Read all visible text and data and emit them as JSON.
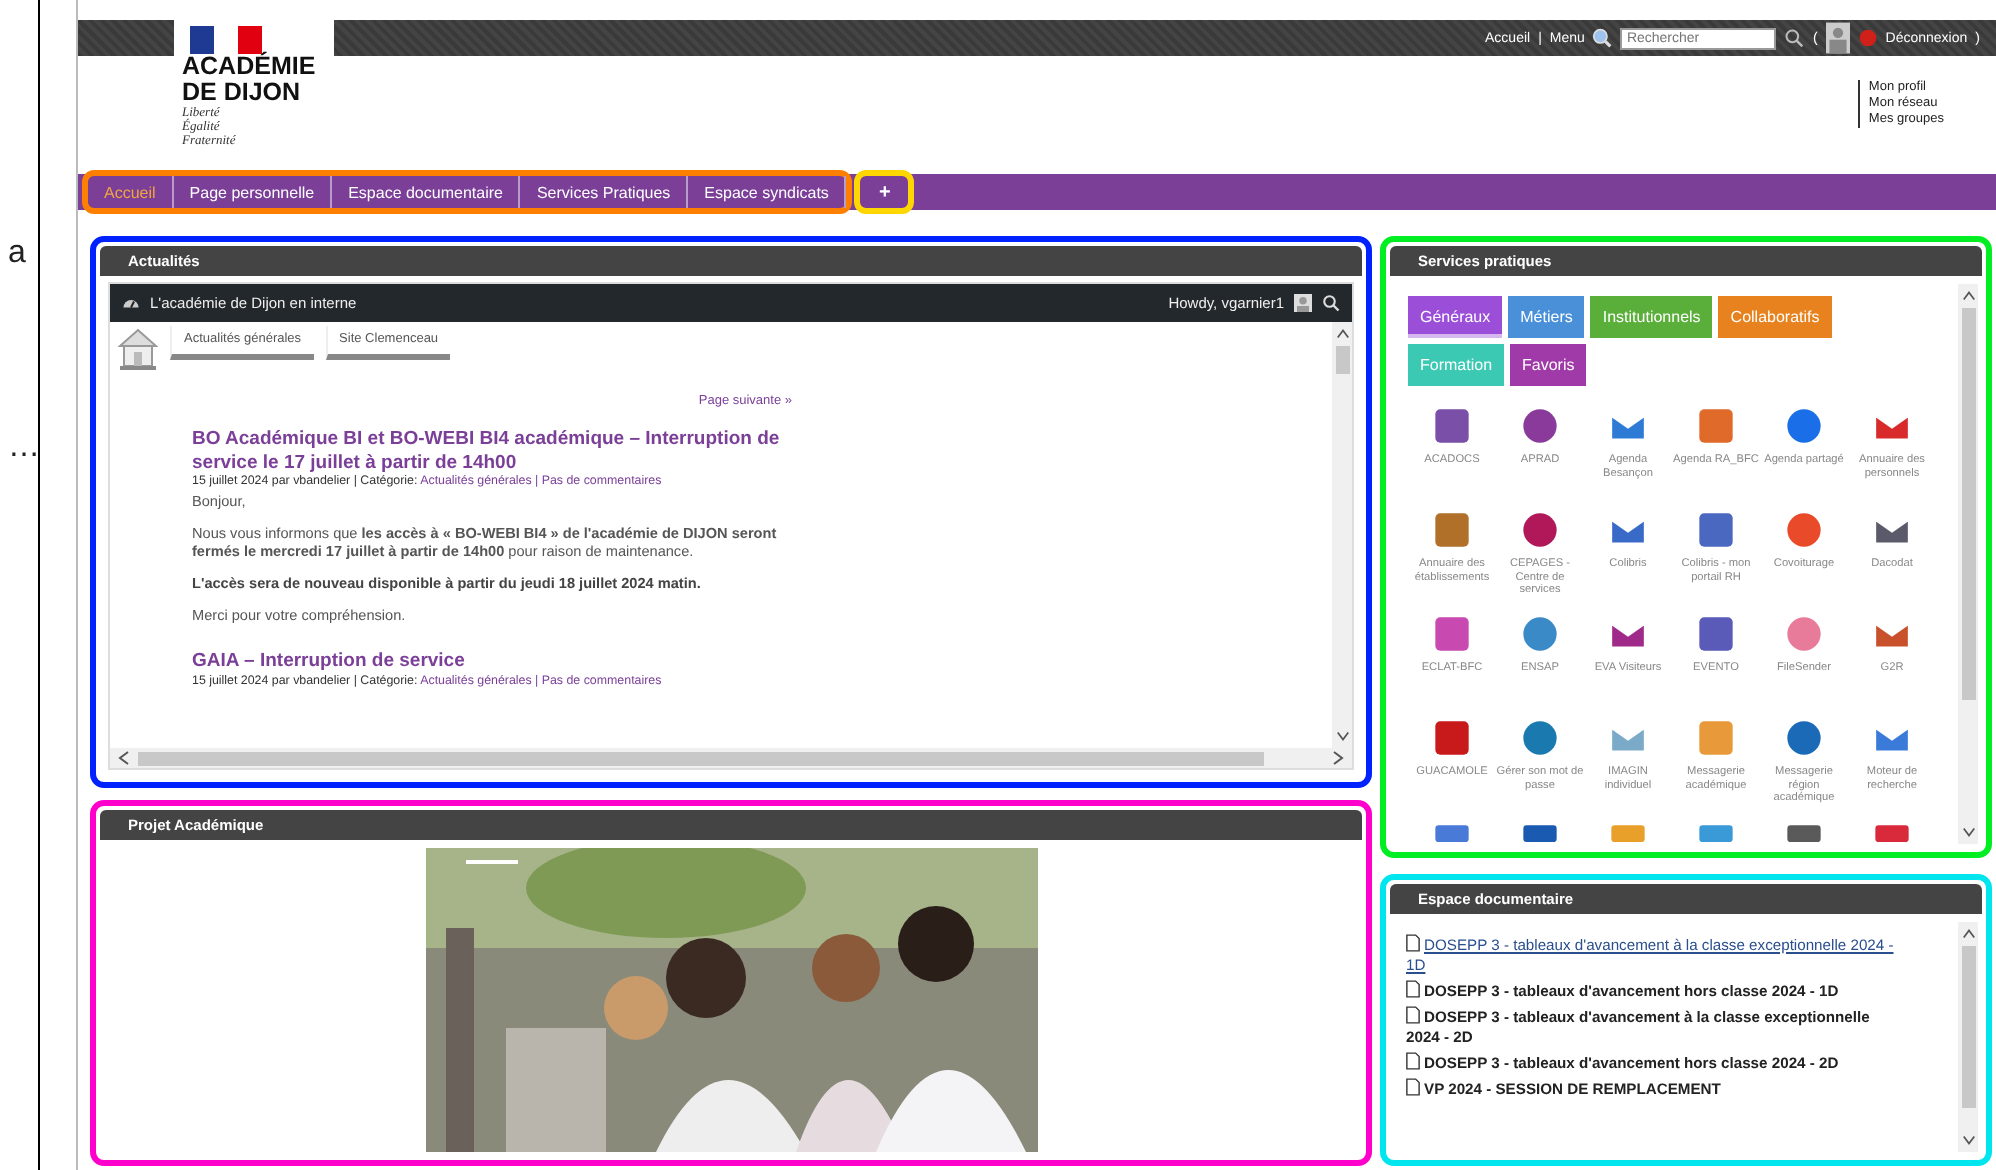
{
  "margin_texts": [
    "a",
    "…"
  ],
  "header": {
    "logo_lines": [
      "ACADÉMIE",
      "DE DIJON"
    ],
    "motto": [
      "Liberté",
      "Égalité",
      "Fraternité"
    ],
    "top_links": [
      "Accueil",
      "Menu"
    ],
    "separator": "|",
    "search": {
      "placeholder": "Rechercher"
    },
    "paren_open": "(",
    "logout": "Déconnexion",
    "paren_close": ")",
    "profile_links": [
      "Mon profil",
      "Mon réseau",
      "Mes groupes"
    ]
  },
  "nav": {
    "color": "#ff7f00",
    "tabs": [
      {
        "label": "Accueil",
        "selected": true
      },
      {
        "label": "Page personnelle",
        "selected": false
      },
      {
        "label": "Espace documentaire",
        "selected": false
      },
      {
        "label": "Services Pratiques",
        "selected": false
      },
      {
        "label": "Espace syndicats",
        "selected": false
      }
    ],
    "plus": {
      "label": "+",
      "color": "#ffd700"
    }
  },
  "news": {
    "title": "Actualités",
    "color": "#0022ff",
    "site_title": "L'académie de Dijon en interne",
    "greeting": "Howdy, vgarnier1",
    "tabs": [
      "Actualités générales",
      "Site Clemenceau"
    ],
    "next_page": "Page suivante »",
    "posts": [
      {
        "title": "BO Académique BI et BO-WEBI BI4 académique – Interruption de service le 17 juillet à partir de 14h00",
        "meta": "15 juillet 2024 par vbandelier | Catégorie:",
        "meta_links": "Actualités générales | Pas de commentaires",
        "paragraphs": [
          {
            "kind": "plain",
            "text": "Bonjour,"
          },
          {
            "kind": "plain",
            "text": "Nous vous informons que **les accès à « BO-WEBI BI4 » de l'académie de DIJON seront fermés le mercredi 17 juillet à partir de 14h00** pour raison de maintenance."
          },
          {
            "kind": "bold",
            "text": "L'accès sera de nouveau disponible à partir du jeudi 18 juillet 2024 matin."
          },
          {
            "kind": "plain",
            "text": "Merci pour votre compréhension."
          }
        ]
      },
      {
        "title": "GAIA – Interruption de service",
        "meta": "15 juillet 2024 par vbandelier | Catégorie:",
        "meta_links": "Actualités générales | Pas de commentaires"
      }
    ]
  },
  "project": {
    "title": "Projet Académique",
    "color": "#ff00cc"
  },
  "services": {
    "title": "Services pratiques",
    "color": "#00ee22",
    "filters": [
      {
        "label": "Généraux",
        "color": "#9b4fd8",
        "selected": true
      },
      {
        "label": "Métiers",
        "color": "#4a90d9",
        "selected": false
      },
      {
        "label": "Institutionnels",
        "color": "#5aae3a",
        "selected": false
      },
      {
        "label": "Collaboratifs",
        "color": "#e8821e",
        "selected": false
      },
      {
        "label": "Formation",
        "color": "#3cc9b4",
        "selected": false
      },
      {
        "label": "Favoris",
        "color": "#a03aa8",
        "selected": false
      }
    ],
    "items": [
      {
        "label": "ACADOCS",
        "color": "#7a4fa8"
      },
      {
        "label": "APRAD",
        "color": "#8a3a9a"
      },
      {
        "label": "Agenda Besançon",
        "color": "#2e7bd6"
      },
      {
        "label": "Agenda RA_BFC",
        "color": "#e06a2a"
      },
      {
        "label": "Agenda partagé",
        "color": "#1a6fe8"
      },
      {
        "label": "Annuaire des personnels",
        "color": "#d82a2a"
      },
      {
        "label": "Annuaire des établissements",
        "color": "#b0702a"
      },
      {
        "label": "CEPAGES - Centre de services",
        "color": "#b0185a"
      },
      {
        "label": "Colibris",
        "color": "#3a6ac8"
      },
      {
        "label": "Colibris - mon portail RH",
        "color": "#4a68c0"
      },
      {
        "label": "Covoiturage",
        "color": "#e84a2a"
      },
      {
        "label": "Dacodat",
        "color": "#5a5a6a"
      },
      {
        "label": "ECLAT-BFC",
        "color": "#c84ab0"
      },
      {
        "label": "ENSAP",
        "color": "#3a8ac8"
      },
      {
        "label": "EVA Visiteurs",
        "color": "#a02a8a"
      },
      {
        "label": "EVENTO",
        "color": "#5a5ab8"
      },
      {
        "label": "FileSender",
        "color": "#e87a9a"
      },
      {
        "label": "G2R",
        "color": "#c8502a"
      },
      {
        "label": "GUACAMOLE",
        "color": "#c81a1a"
      },
      {
        "label": "Gérer son mot de passe",
        "color": "#1a7ab0"
      },
      {
        "label": "IMAGIN individuel",
        "color": "#7aaac8"
      },
      {
        "label": "Messagerie académique",
        "color": "#e89a3a"
      },
      {
        "label": "Messagerie région académique",
        "color": "#1a6ab8"
      },
      {
        "label": "Moteur de recherche",
        "color": "#3a7ad8"
      },
      {
        "kind": "cut",
        "color": "#4a7ad8"
      },
      {
        "kind": "cut",
        "color": "#1a5ab0"
      },
      {
        "kind": "cut",
        "color": "#e8a02a"
      },
      {
        "kind": "cut",
        "color": "#3a9ad8"
      },
      {
        "kind": "cut",
        "color": "#5a5a5a"
      },
      {
        "kind": "cut",
        "color": "#d82a3a"
      }
    ]
  },
  "documents": {
    "title": "Espace documentaire",
    "color": "#00e5ee",
    "items": [
      {
        "label": "DOSEPP 3 - tableaux d'avancement à la classe exceptionnelle 2024 - 1D",
        "hovered": true
      },
      {
        "label": "DOSEPP 3 - tableaux d'avancement hors classe 2024 - 1D",
        "hovered": false
      },
      {
        "label": "DOSEPP 3 - tableaux d'avancement à la classe exceptionnelle 2024 - 2D",
        "hovered": false
      },
      {
        "label": "DOSEPP 3 - tableaux d'avancement hors classe 2024 - 2D",
        "hovered": false
      },
      {
        "label": "VP 2024 - SESSION DE REMPLACEMENT",
        "hovered": false
      }
    ]
  }
}
